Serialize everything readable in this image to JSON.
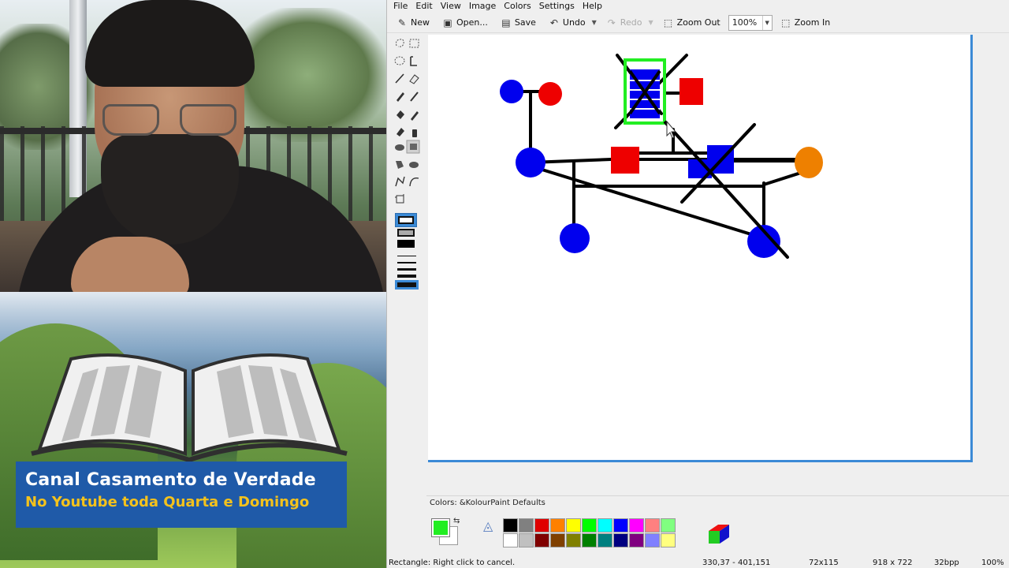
{
  "banner": {
    "line1": "Canal Casamento de Verdade",
    "line2": "No Youtube toda Quarta e Domingo"
  },
  "menubar": {
    "items": [
      "File",
      "Edit",
      "View",
      "Image",
      "Colors",
      "Settings",
      "Help"
    ]
  },
  "toolbar": {
    "new_label": "New",
    "open_label": "Open...",
    "save_label": "Save",
    "undo_label": "Undo",
    "redo_label": "Redo",
    "zoom_out_label": "Zoom Out",
    "zoom_value": "100%",
    "zoom_in_label": "Zoom In"
  },
  "tools": [
    "free-form-selection-icon",
    "rectangular-selection-icon",
    "elliptical-selection-icon",
    "text-icon",
    "line-icon",
    "eraser-icon",
    "pen-icon",
    "brush-icon",
    "flood-fill-icon",
    "color-picker-icon",
    "color-eraser-icon",
    "spraycan-icon",
    "ellipse-icon",
    "rectangle-icon",
    "polygon-icon",
    "rounded-rectangle-icon",
    "polyline-icon",
    "curve-icon",
    "resize-icon"
  ],
  "colorbox": {
    "title": "Colors: &KolourPaint Defaults",
    "foreground": "#22ee22",
    "background": "#ffffff",
    "palette_top": [
      "#000000",
      "#808080",
      "#e00000",
      "#ff8000",
      "#ffff00",
      "#00ff00",
      "#00ffff",
      "#0000ff",
      "#ff00ff",
      "#ff8080",
      "#80ff80"
    ],
    "palette_bottom": [
      "#ffffff",
      "#c0c0c0",
      "#800000",
      "#804000",
      "#808000",
      "#008000",
      "#008080",
      "#000080",
      "#800080",
      "#8080ff",
      "#ffff80"
    ]
  },
  "statusbar": {
    "message": "Rectangle: Right click to cancel.",
    "coords": "330,37 - 401,151",
    "selection_size": "72x115",
    "image_size": "918 x 722",
    "depth": "32bpp",
    "zoom": "100%"
  }
}
